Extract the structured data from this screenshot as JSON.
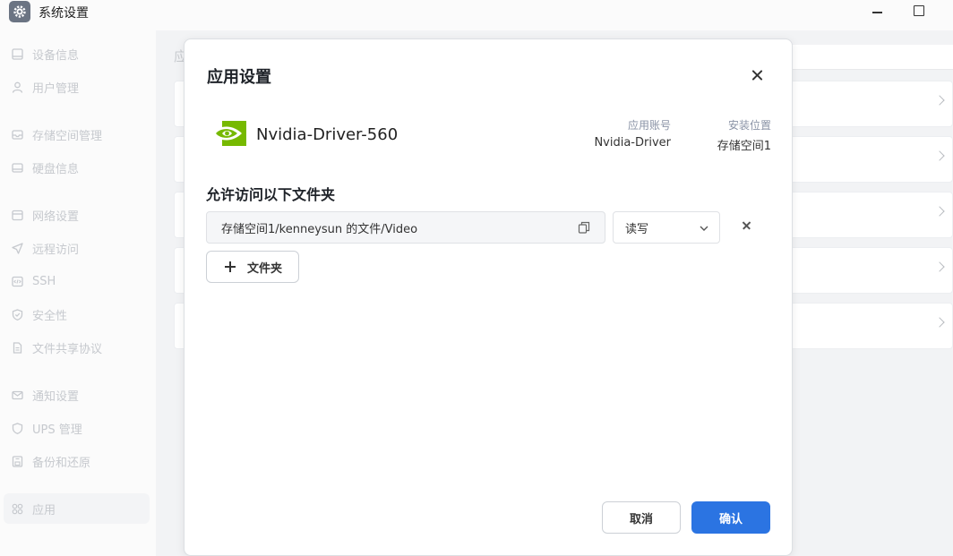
{
  "window": {
    "title": "系统设置",
    "icon": "gear-icon"
  },
  "sidebar": {
    "items": [
      {
        "label": "设备信息",
        "icon": "device-info-icon"
      },
      {
        "label": "用户管理",
        "icon": "user-icon"
      },
      {
        "label": "存储空间管理",
        "icon": "storage-icon"
      },
      {
        "label": "硬盘信息",
        "icon": "disk-icon"
      },
      {
        "label": "网络设置",
        "icon": "network-icon"
      },
      {
        "label": "远程访问",
        "icon": "send-icon"
      },
      {
        "label": "SSH",
        "icon": "code-icon"
      },
      {
        "label": "安全性",
        "icon": "shield-icon"
      },
      {
        "label": "文件共享协议",
        "icon": "file-icon"
      },
      {
        "label": "通知设置",
        "icon": "mail-icon"
      },
      {
        "label": "UPS 管理",
        "icon": "ups-shield-icon"
      },
      {
        "label": "备份和还原",
        "icon": "backup-icon"
      },
      {
        "label": "应用",
        "icon": "apps-icon",
        "active": true
      }
    ]
  },
  "background": {
    "heading": "应"
  },
  "dialog": {
    "title": "应用设置",
    "app": {
      "name": "Nvidia-Driver-560",
      "logo": "nvidia-logo",
      "account_label": "应用账号",
      "account_value": "Nvidia-Driver",
      "location_label": "安装位置",
      "location_value": "存储空间1"
    },
    "folders_title": "允许访问以下文件夹",
    "folders": [
      {
        "path": "存储空间1/kenneysun 的文件/Video",
        "permission": "读写"
      }
    ],
    "add_folder_label": "文件夹",
    "cancel_label": "取消",
    "confirm_label": "确认"
  },
  "colors": {
    "primary": "#2b74e2",
    "nvidia_green": "#76b900"
  }
}
